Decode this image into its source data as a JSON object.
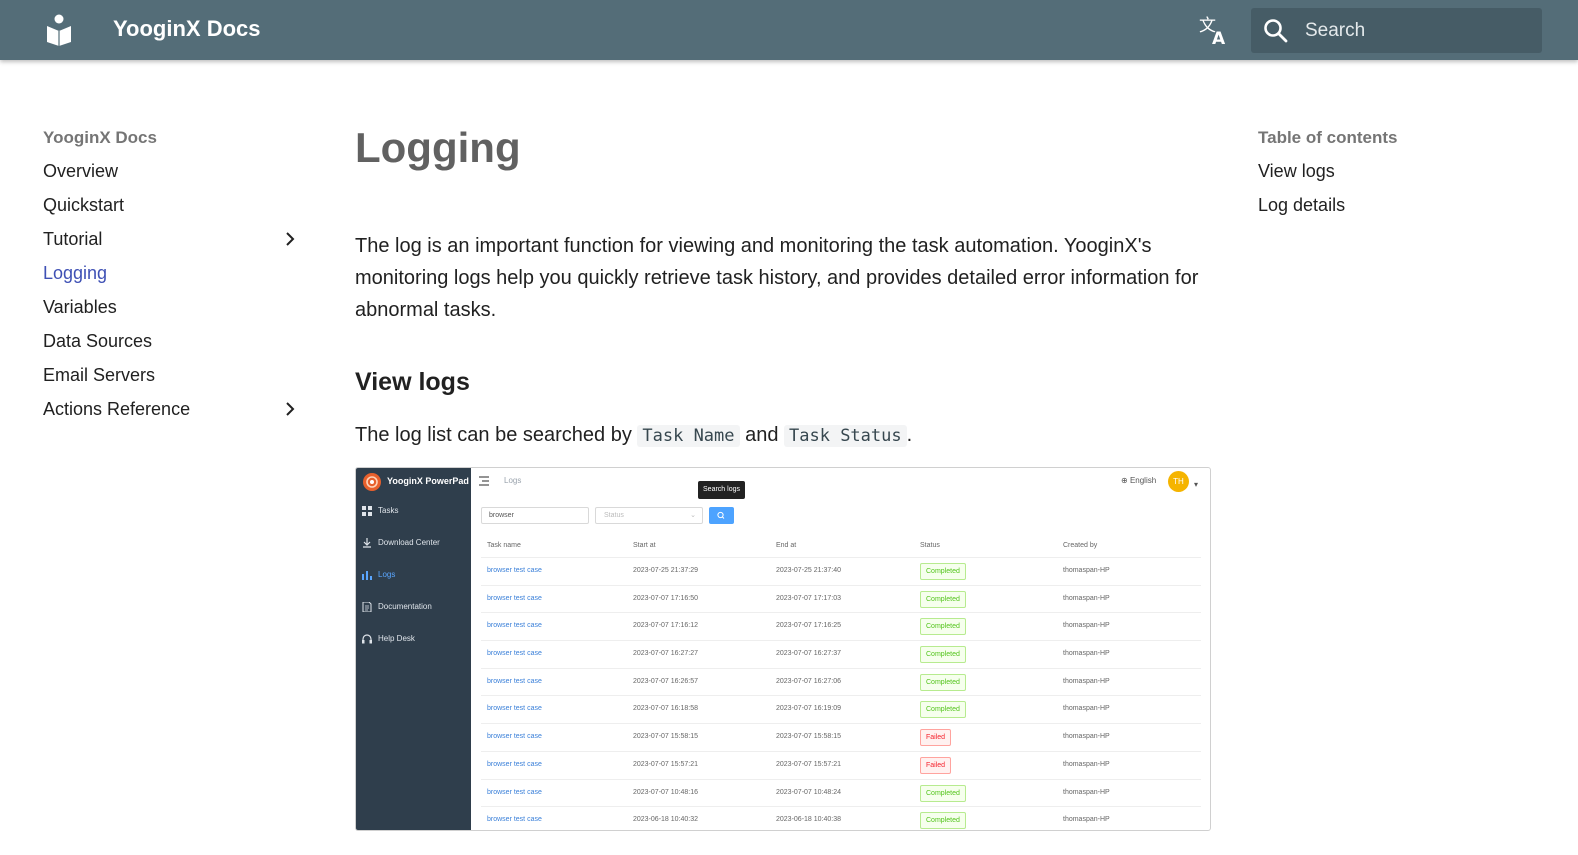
{
  "header": {
    "site_title": "YooginX Docs",
    "search_placeholder": "Search"
  },
  "left_nav": {
    "heading": "YooginX Docs",
    "items": [
      {
        "label": "Overview",
        "active": false,
        "expandable": false
      },
      {
        "label": "Quickstart",
        "active": false,
        "expandable": false
      },
      {
        "label": "Tutorial",
        "active": false,
        "expandable": true
      },
      {
        "label": "Logging",
        "active": true,
        "expandable": false
      },
      {
        "label": "Variables",
        "active": false,
        "expandable": false
      },
      {
        "label": "Data Sources",
        "active": false,
        "expandable": false
      },
      {
        "label": "Email Servers",
        "active": false,
        "expandable": false
      },
      {
        "label": "Actions Reference",
        "active": false,
        "expandable": true
      }
    ]
  },
  "main": {
    "title": "Logging",
    "intro": "The log is an important function for viewing and monitoring the task automation. YooginX's monitoring logs help you quickly retrieve task history, and provides detailed error information for abnormal tasks.",
    "section_view_logs": "View logs",
    "search_text_1": "The log list can be searched by",
    "code_task_name": "Task Name",
    "search_text_2": "and",
    "code_task_status": "Task Status",
    "search_text_3": "."
  },
  "screenshot": {
    "brand": "YooginX PowerPad",
    "menu": [
      {
        "label": "Tasks",
        "icon": "grid-icon"
      },
      {
        "label": "Download Center",
        "icon": "download-icon"
      },
      {
        "label": "Logs",
        "icon": "bar-chart-icon"
      },
      {
        "label": "Documentation",
        "icon": "document-icon"
      },
      {
        "label": "Help Desk",
        "icon": "headset-icon"
      }
    ],
    "breadcrumb": "Logs",
    "language": "English",
    "avatar": "TH",
    "tooltip": "Search logs",
    "filter_value": "browser",
    "status_placeholder": "Status",
    "columns": [
      "Task name",
      "Start at",
      "End at",
      "Status",
      "Created by"
    ],
    "rows": [
      {
        "name": "browser test case",
        "start": "2023-07-25 21:37:29",
        "end": "2023-07-25 21:37:40",
        "status": "Completed",
        "by": "thomaspan-HP"
      },
      {
        "name": "browser test case",
        "start": "2023-07-07 17:16:50",
        "end": "2023-07-07 17:17:03",
        "status": "Completed",
        "by": "thomaspan-HP"
      },
      {
        "name": "browser test case",
        "start": "2023-07-07 17:16:12",
        "end": "2023-07-07 17:16:25",
        "status": "Completed",
        "by": "thomaspan-HP"
      },
      {
        "name": "browser test case",
        "start": "2023-07-07 16:27:27",
        "end": "2023-07-07 16:27:37",
        "status": "Completed",
        "by": "thomaspan-HP"
      },
      {
        "name": "browser test case",
        "start": "2023-07-07 16:26:57",
        "end": "2023-07-07 16:27:06",
        "status": "Completed",
        "by": "thomaspan-HP"
      },
      {
        "name": "browser test case",
        "start": "2023-07-07 16:18:58",
        "end": "2023-07-07 16:19:09",
        "status": "Completed",
        "by": "thomaspan-HP"
      },
      {
        "name": "browser test case",
        "start": "2023-07-07 15:58:15",
        "end": "2023-07-07 15:58:15",
        "status": "Failed",
        "by": "thomaspan-HP"
      },
      {
        "name": "browser test case",
        "start": "2023-07-07 15:57:21",
        "end": "2023-07-07 15:57:21",
        "status": "Failed",
        "by": "thomaspan-HP"
      },
      {
        "name": "browser test case",
        "start": "2023-07-07 10:48:16",
        "end": "2023-07-07 10:48:24",
        "status": "Completed",
        "by": "thomaspan-HP"
      },
      {
        "name": "browser test case",
        "start": "2023-06-18 10:40:32",
        "end": "2023-06-18 10:40:38",
        "status": "Completed",
        "by": "thomaspan-HP"
      }
    ]
  },
  "toc": {
    "heading": "Table of contents",
    "items": [
      "View logs",
      "Log details"
    ]
  },
  "colors": {
    "header_bg": "#546d78",
    "accent": "#3f51b5",
    "completed": "#52c41a",
    "failed": "#f5222d"
  }
}
